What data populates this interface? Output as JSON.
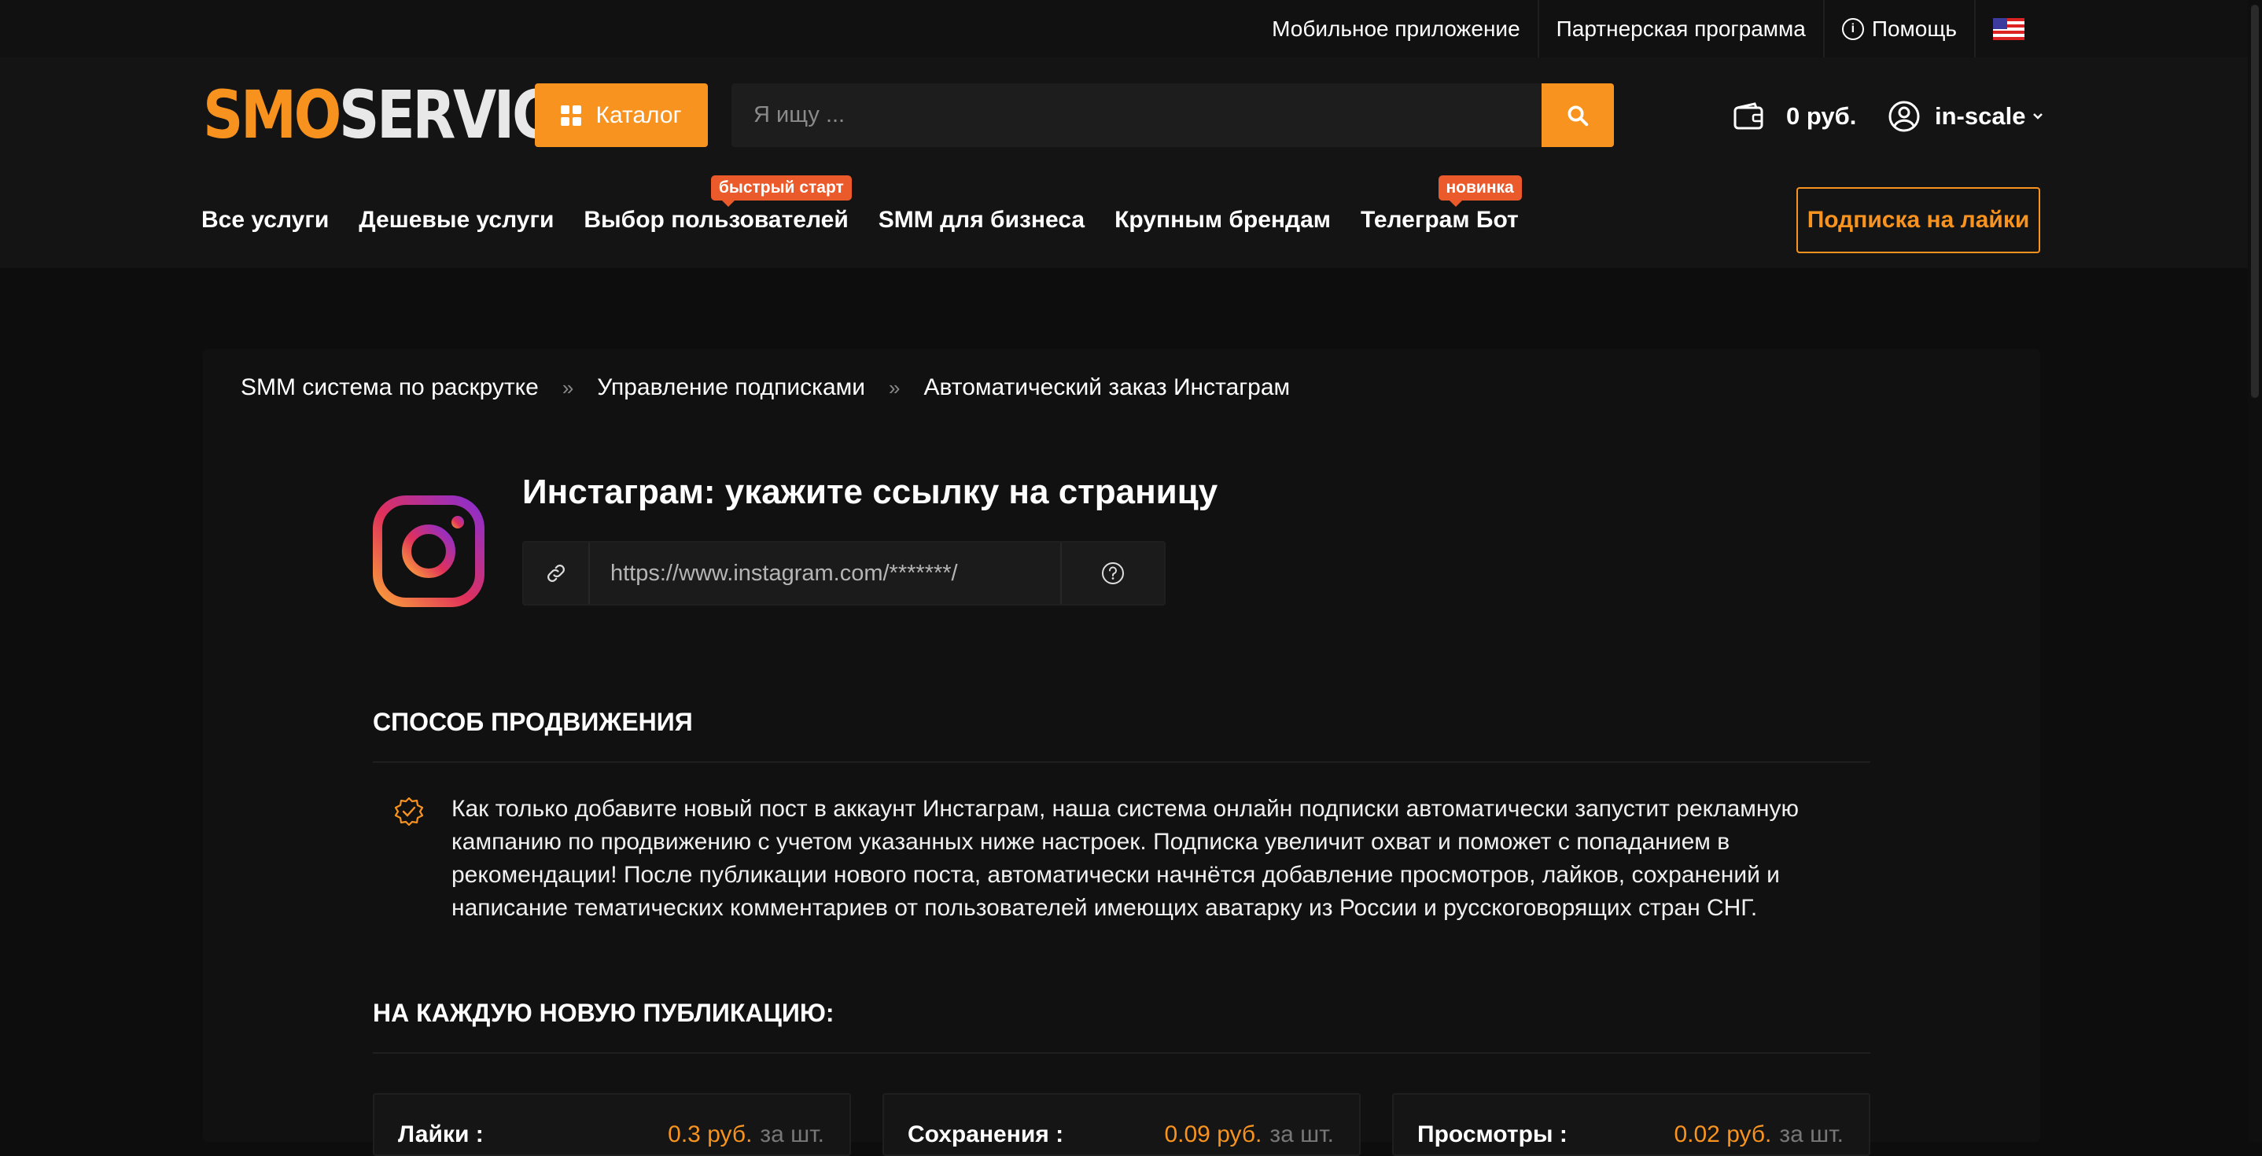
{
  "topbar": {
    "links": [
      "Мобильное приложение",
      "Партнерская программа"
    ],
    "help_label": "Помощь"
  },
  "header": {
    "logo_part1": "SMO",
    "logo_part2": "SERVICE",
    "catalog_label": "Каталог",
    "search_placeholder": "Я ищу ...",
    "balance": "0 руб.",
    "username": "in-scale",
    "nav": [
      {
        "label": "Все услуги",
        "badge": ""
      },
      {
        "label": "Дешевые услуги",
        "badge": ""
      },
      {
        "label": "Выбор пользователей",
        "badge": "быстрый старт"
      },
      {
        "label": "SMM для бизнеса",
        "badge": ""
      },
      {
        "label": "Крупным брендам",
        "badge": ""
      },
      {
        "label": "Телеграм Бот",
        "badge": "новинка"
      }
    ],
    "subscribe_label": "Подписка на лайки"
  },
  "breadcrumb": [
    "SMM система по раскрутке",
    "Управление подписками",
    "Автоматический заказ Инстаграм"
  ],
  "main": {
    "title": "Инстаграм: укажите ссылку на страницу",
    "url_placeholder": "https://www.instagram.com/*******/",
    "section_promo": "СПОСОБ ПРОДВИЖЕНИЯ",
    "promo_text": "Как только добавите новый пост в аккаунт Инстаграм, наша система онлайн подписки автоматически запустит рекламную кампанию по продвижению с учетом указанных ниже настроек. Подписка увеличит охват и поможет с попаданием в рекомендации! После публикации нового поста, автоматически начнётся добавление просмотров, лайков, сохранений и написание тематических комментариев от пользователей имеющих аватарку из России и русскоговорящих стран СНГ.",
    "section_each": "НА КАЖДУЮ НОВУЮ ПУБЛИКАЦИЮ:",
    "prices": [
      {
        "name": "Лайки :",
        "amount": "0.3 руб.",
        "unit": "за шт."
      },
      {
        "name": "Сохранения :",
        "amount": "0.09 руб.",
        "unit": "за шт."
      },
      {
        "name": "Просмотры :",
        "amount": "0.02 руб.",
        "unit": "за шт."
      }
    ]
  },
  "colors": {
    "accent": "#f7931e",
    "badge": "#ea5a2a",
    "background": "#0d0d0d"
  },
  "icons": [
    "info-icon",
    "us-flag-icon",
    "grid-icon",
    "search-icon",
    "wallet-icon",
    "user-icon",
    "chevron-down-icon",
    "instagram-logo-icon",
    "link-icon",
    "question-icon",
    "verified-badge-icon"
  ]
}
